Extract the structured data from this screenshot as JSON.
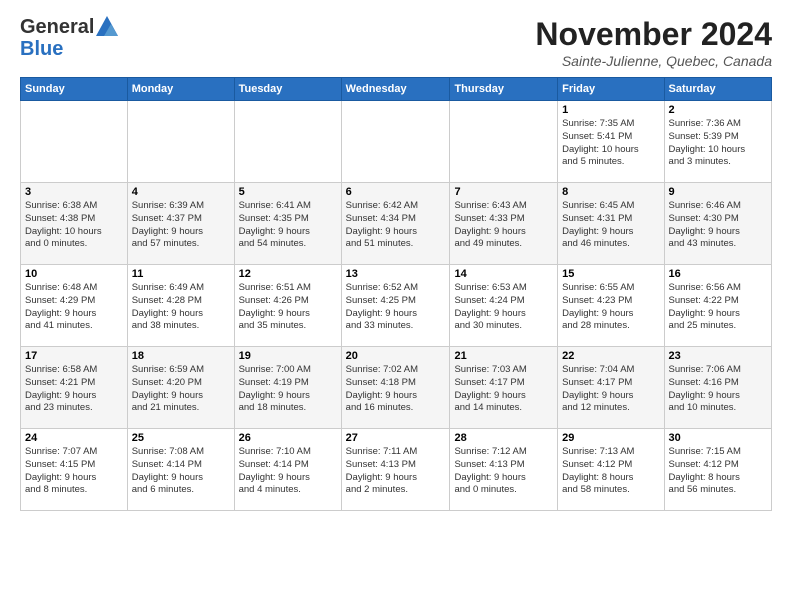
{
  "logo": {
    "general": "General",
    "blue": "Blue"
  },
  "header": {
    "title": "November 2024",
    "location": "Sainte-Julienne, Quebec, Canada"
  },
  "days_of_week": [
    "Sunday",
    "Monday",
    "Tuesday",
    "Wednesday",
    "Thursday",
    "Friday",
    "Saturday"
  ],
  "weeks": [
    [
      {
        "day": "",
        "info": ""
      },
      {
        "day": "",
        "info": ""
      },
      {
        "day": "",
        "info": ""
      },
      {
        "day": "",
        "info": ""
      },
      {
        "day": "",
        "info": ""
      },
      {
        "day": "1",
        "info": "Sunrise: 7:35 AM\nSunset: 5:41 PM\nDaylight: 10 hours\nand 5 minutes."
      },
      {
        "day": "2",
        "info": "Sunrise: 7:36 AM\nSunset: 5:39 PM\nDaylight: 10 hours\nand 3 minutes."
      }
    ],
    [
      {
        "day": "3",
        "info": "Sunrise: 6:38 AM\nSunset: 4:38 PM\nDaylight: 10 hours\nand 0 minutes."
      },
      {
        "day": "4",
        "info": "Sunrise: 6:39 AM\nSunset: 4:37 PM\nDaylight: 9 hours\nand 57 minutes."
      },
      {
        "day": "5",
        "info": "Sunrise: 6:41 AM\nSunset: 4:35 PM\nDaylight: 9 hours\nand 54 minutes."
      },
      {
        "day": "6",
        "info": "Sunrise: 6:42 AM\nSunset: 4:34 PM\nDaylight: 9 hours\nand 51 minutes."
      },
      {
        "day": "7",
        "info": "Sunrise: 6:43 AM\nSunset: 4:33 PM\nDaylight: 9 hours\nand 49 minutes."
      },
      {
        "day": "8",
        "info": "Sunrise: 6:45 AM\nSunset: 4:31 PM\nDaylight: 9 hours\nand 46 minutes."
      },
      {
        "day": "9",
        "info": "Sunrise: 6:46 AM\nSunset: 4:30 PM\nDaylight: 9 hours\nand 43 minutes."
      }
    ],
    [
      {
        "day": "10",
        "info": "Sunrise: 6:48 AM\nSunset: 4:29 PM\nDaylight: 9 hours\nand 41 minutes."
      },
      {
        "day": "11",
        "info": "Sunrise: 6:49 AM\nSunset: 4:28 PM\nDaylight: 9 hours\nand 38 minutes."
      },
      {
        "day": "12",
        "info": "Sunrise: 6:51 AM\nSunset: 4:26 PM\nDaylight: 9 hours\nand 35 minutes."
      },
      {
        "day": "13",
        "info": "Sunrise: 6:52 AM\nSunset: 4:25 PM\nDaylight: 9 hours\nand 33 minutes."
      },
      {
        "day": "14",
        "info": "Sunrise: 6:53 AM\nSunset: 4:24 PM\nDaylight: 9 hours\nand 30 minutes."
      },
      {
        "day": "15",
        "info": "Sunrise: 6:55 AM\nSunset: 4:23 PM\nDaylight: 9 hours\nand 28 minutes."
      },
      {
        "day": "16",
        "info": "Sunrise: 6:56 AM\nSunset: 4:22 PM\nDaylight: 9 hours\nand 25 minutes."
      }
    ],
    [
      {
        "day": "17",
        "info": "Sunrise: 6:58 AM\nSunset: 4:21 PM\nDaylight: 9 hours\nand 23 minutes."
      },
      {
        "day": "18",
        "info": "Sunrise: 6:59 AM\nSunset: 4:20 PM\nDaylight: 9 hours\nand 21 minutes."
      },
      {
        "day": "19",
        "info": "Sunrise: 7:00 AM\nSunset: 4:19 PM\nDaylight: 9 hours\nand 18 minutes."
      },
      {
        "day": "20",
        "info": "Sunrise: 7:02 AM\nSunset: 4:18 PM\nDaylight: 9 hours\nand 16 minutes."
      },
      {
        "day": "21",
        "info": "Sunrise: 7:03 AM\nSunset: 4:17 PM\nDaylight: 9 hours\nand 14 minutes."
      },
      {
        "day": "22",
        "info": "Sunrise: 7:04 AM\nSunset: 4:17 PM\nDaylight: 9 hours\nand 12 minutes."
      },
      {
        "day": "23",
        "info": "Sunrise: 7:06 AM\nSunset: 4:16 PM\nDaylight: 9 hours\nand 10 minutes."
      }
    ],
    [
      {
        "day": "24",
        "info": "Sunrise: 7:07 AM\nSunset: 4:15 PM\nDaylight: 9 hours\nand 8 minutes."
      },
      {
        "day": "25",
        "info": "Sunrise: 7:08 AM\nSunset: 4:14 PM\nDaylight: 9 hours\nand 6 minutes."
      },
      {
        "day": "26",
        "info": "Sunrise: 7:10 AM\nSunset: 4:14 PM\nDaylight: 9 hours\nand 4 minutes."
      },
      {
        "day": "27",
        "info": "Sunrise: 7:11 AM\nSunset: 4:13 PM\nDaylight: 9 hours\nand 2 minutes."
      },
      {
        "day": "28",
        "info": "Sunrise: 7:12 AM\nSunset: 4:13 PM\nDaylight: 9 hours\nand 0 minutes."
      },
      {
        "day": "29",
        "info": "Sunrise: 7:13 AM\nSunset: 4:12 PM\nDaylight: 8 hours\nand 58 minutes."
      },
      {
        "day": "30",
        "info": "Sunrise: 7:15 AM\nSunset: 4:12 PM\nDaylight: 8 hours\nand 56 minutes."
      }
    ]
  ]
}
